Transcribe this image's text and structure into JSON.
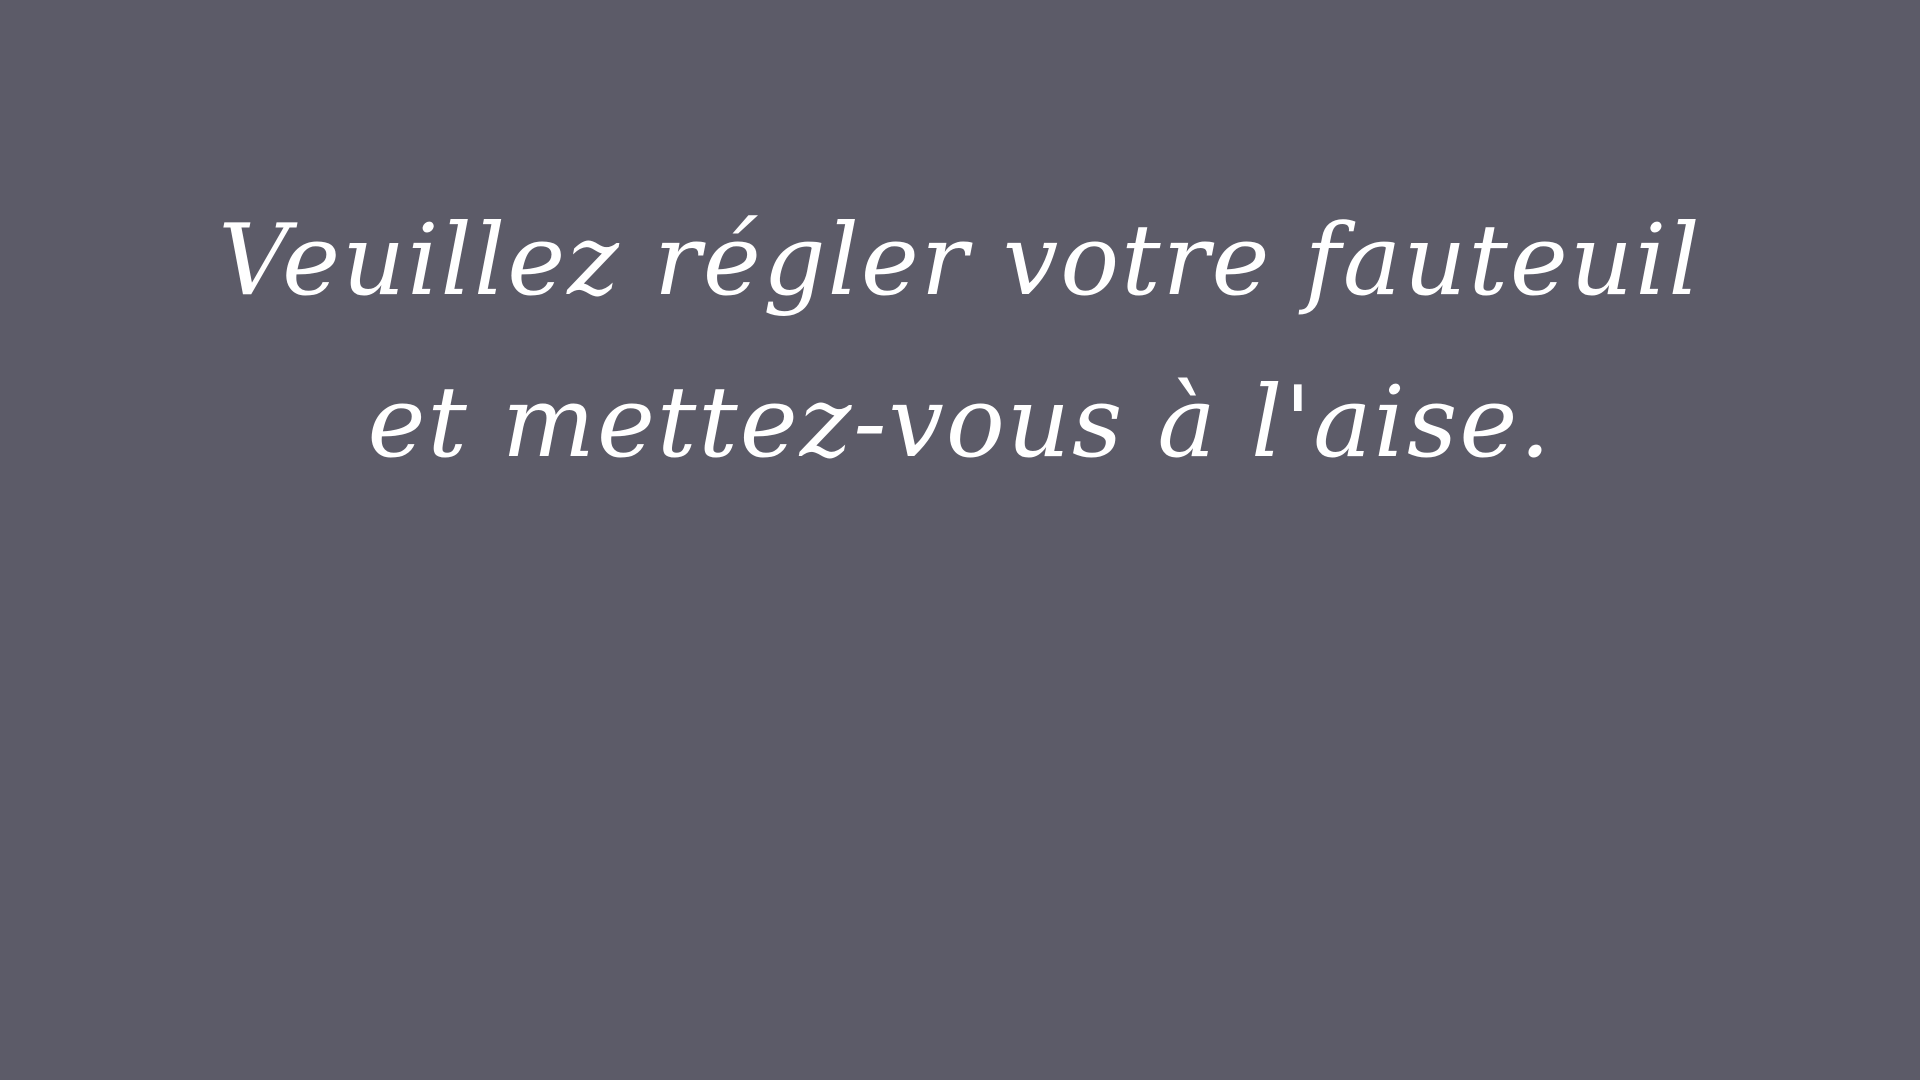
{
  "background_color": "#5c5b68",
  "text_color": "#ffffff",
  "message": {
    "line1": "Veuillez régler votre fauteuil",
    "line2": "et mettez-vous à l'aise."
  }
}
